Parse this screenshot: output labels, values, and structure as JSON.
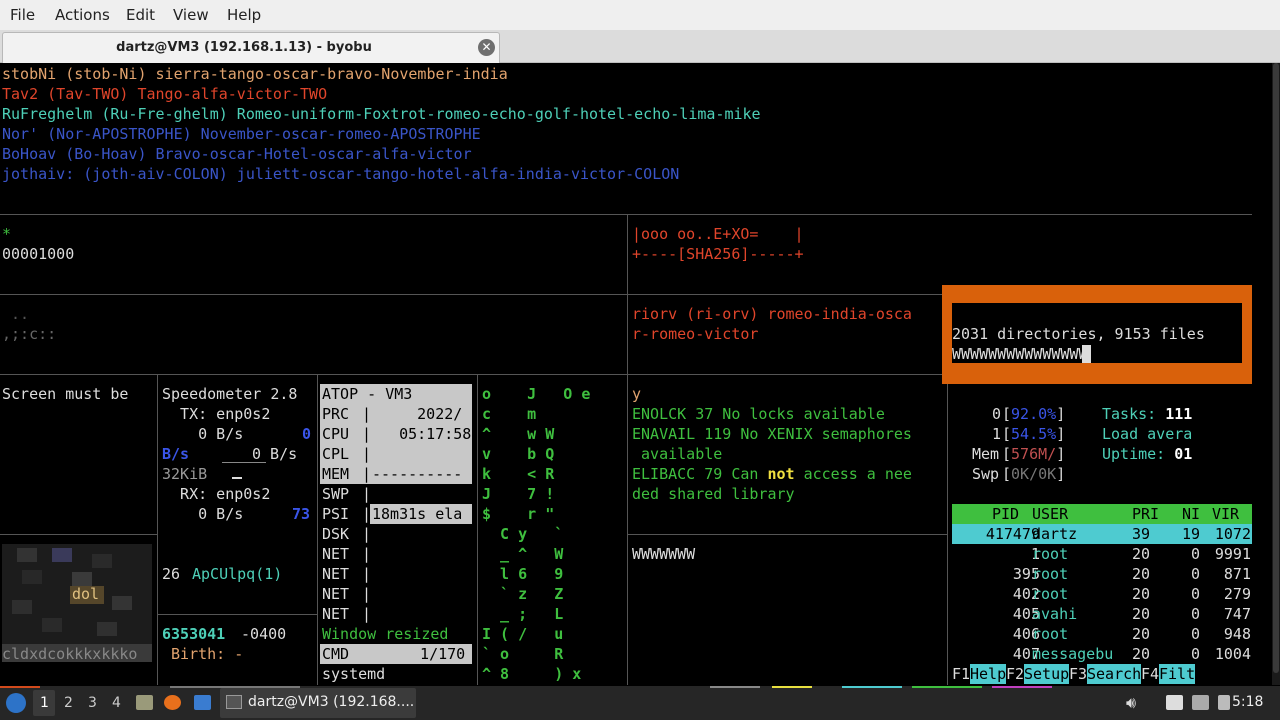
{
  "menubar": {
    "items": [
      "File",
      "Actions",
      "Edit",
      "View",
      "Help"
    ]
  },
  "tab": {
    "title": "dartz@VM3 (192.168.1.13) - byobu",
    "close_icon": "close-icon"
  },
  "top_lines": [
    {
      "text": "stobNi (stob-Ni) sierra-tango-oscar-bravo-November-india",
      "color": "#e2a36e"
    },
    {
      "text": "Tav2 (Tav-TWO) Tango-alfa-victor-TWO",
      "color": "#e0452b"
    },
    {
      "text": "RuFreghelm (Ru-Fre-ghelm) Romeo-uniform-Foxtrot-romeo-echo-golf-hotel-echo-lima-mike",
      "color": "#4ed0b8"
    },
    {
      "text": "Nor' (Nor-APOSTROPHE) November-oscar-romeo-APOSTROPHE",
      "color": "#3a55c8"
    },
    {
      "text": "BoHoav (Bo-Hoav) Bravo-oscar-Hotel-oscar-alfa-victor",
      "color": "#3a55c8"
    },
    {
      "text": "jothaiv: (joth-aiv-COLON) juliett-oscar-tango-hotel-alfa-india-victor-COLON",
      "color": "#3a55c8"
    }
  ],
  "pane_hex": {
    "star": "*",
    "value": "00001000"
  },
  "pane_sha": {
    "line1": "|ooo oo..E+XO=    |",
    "line2": "+----[SHA256]-----+"
  },
  "pane_dots": {
    "line1": " ..",
    "line2": ",;:c::"
  },
  "pane_phonetic": {
    "line1": "riorv (ri-orv) romeo-india-osca",
    "line2": "r-romeo-victor"
  },
  "popup": {
    "line1": "2031 directories, 9153 files",
    "line2": "WWWWWWWWWWWWWWW",
    "color": "#d9610b"
  },
  "pane_screen": {
    "text": "Screen must be"
  },
  "speedometer": {
    "title": "Speedometer 2.8",
    "tx_iface": "  TX: enp0s2",
    "tx_rate": "    0 B/s",
    "tx_num": "0",
    "unit": "B/s",
    "rx_rate2": "0 B/s",
    "kib": "32KiB",
    "rx_iface": "  RX: enp0s2",
    "rx_rate": "    0 B/s",
    "rx_num": "73"
  },
  "apcu": {
    "num": "26",
    "label": "ApCUlpq(1)"
  },
  "birth": {
    "num": "6353041",
    "tz": " -0400",
    "label": " Birth: -"
  },
  "pixel_label": "dol",
  "pixel_strip": "cldxdcokkkxkkko",
  "atop": {
    "header": "ATOP - VM3",
    "rows": [
      {
        "k": "PRC",
        "v": "     2022/"
      },
      {
        "k": "CPU",
        "v": "   05:17:58"
      },
      {
        "k": "CPL",
        "v": ""
      },
      {
        "k": "MEM",
        "v": "----------"
      },
      {
        "k": "SWP",
        "v": ""
      },
      {
        "k": "PSI",
        "v": "18m31s ela"
      },
      {
        "k": "DSK",
        "v": ""
      },
      {
        "k": "NET",
        "v": ""
      },
      {
        "k": "NET",
        "v": ""
      },
      {
        "k": "NET",
        "v": ""
      },
      {
        "k": "NET",
        "v": ""
      }
    ],
    "resized": "Window resized",
    "cmd_label": "CMD",
    "cmd_value": "  1/170",
    "process": "systemd"
  },
  "matrix": {
    "rows": [
      "o    J   O e",
      "c    m       ",
      "^    w W    ",
      "v    b Q    ",
      "k    < R    ",
      "J    7 !    ",
      "$    r \"    ",
      "  C y   `   ",
      "  _ ^   W   ",
      "  l 6   9   ",
      "  ` z   Z   ",
      "  _ ;   L   ",
      "I ( /   u   ",
      "` o     R   ",
      "^ 8     ) x "
    ]
  },
  "errno": {
    "l0": "y",
    "l1": "ENOLCK 37 No locks available",
    "l2": "ENAVAIL 119 No XENIX semaphores",
    "l3": " available",
    "l4a": "ELIBACC 79 Can ",
    "l4b": "not",
    "l4c": " access a nee",
    "l5": "ded shared library",
    "w": "WWWWWWW"
  },
  "htop": {
    "cpu0_label": "0",
    "cpu0": "92.0%",
    "cpu1_label": "1",
    "cpu1": "54.5%",
    "mem_label": "Mem",
    "mem": "576M/",
    "swp_label": "Swp",
    "swp": "0K/0K",
    "tasks_label": "Tasks: ",
    "tasks": "111",
    "load_label": "Load avera",
    "uptime_label": "Uptime: ",
    "uptime": "01",
    "columns": [
      "PID",
      "USER",
      "PRI",
      "NI",
      "VIR"
    ],
    "processes": [
      {
        "pid": "417479",
        "user": "dartz",
        "pri": "39",
        "ni": "19",
        "virt": "1072"
      },
      {
        "pid": "1",
        "user": "root",
        "pri": "20",
        "ni": "0",
        "virt": "9991"
      },
      {
        "pid": "395",
        "user": "root",
        "pri": "20",
        "ni": "0",
        "virt": "871"
      },
      {
        "pid": "402",
        "user": "root",
        "pri": "20",
        "ni": "0",
        "virt": "279"
      },
      {
        "pid": "405",
        "user": "avahi",
        "pri": "20",
        "ni": "0",
        "virt": "747"
      },
      {
        "pid": "406",
        "user": "root",
        "pri": "20",
        "ni": "0",
        "virt": "948"
      },
      {
        "pid": "407",
        "user": "messagebu",
        "pri": "20",
        "ni": "0",
        "virt": "1004"
      }
    ],
    "fkeys": [
      {
        "key": "F1",
        "label": "Help"
      },
      {
        "key": "F2",
        "label": "Setup"
      },
      {
        "key": "F3",
        "label": "Search"
      },
      {
        "key": "F4",
        "label": "Filt"
      }
    ]
  },
  "taskbar": {
    "workspaces": [
      "1",
      "2",
      "3",
      "4"
    ],
    "task_label": "dartz@VM3 (192.168....",
    "clock": "5:18",
    "icons": [
      "start-menu-icon",
      "show-desktop-icon",
      "firefox-icon",
      "file-manager-icon",
      "terminal-icon",
      "clipboard-icon",
      "volume-icon",
      "network-icon",
      "display-icon",
      "battery-icon"
    ]
  }
}
